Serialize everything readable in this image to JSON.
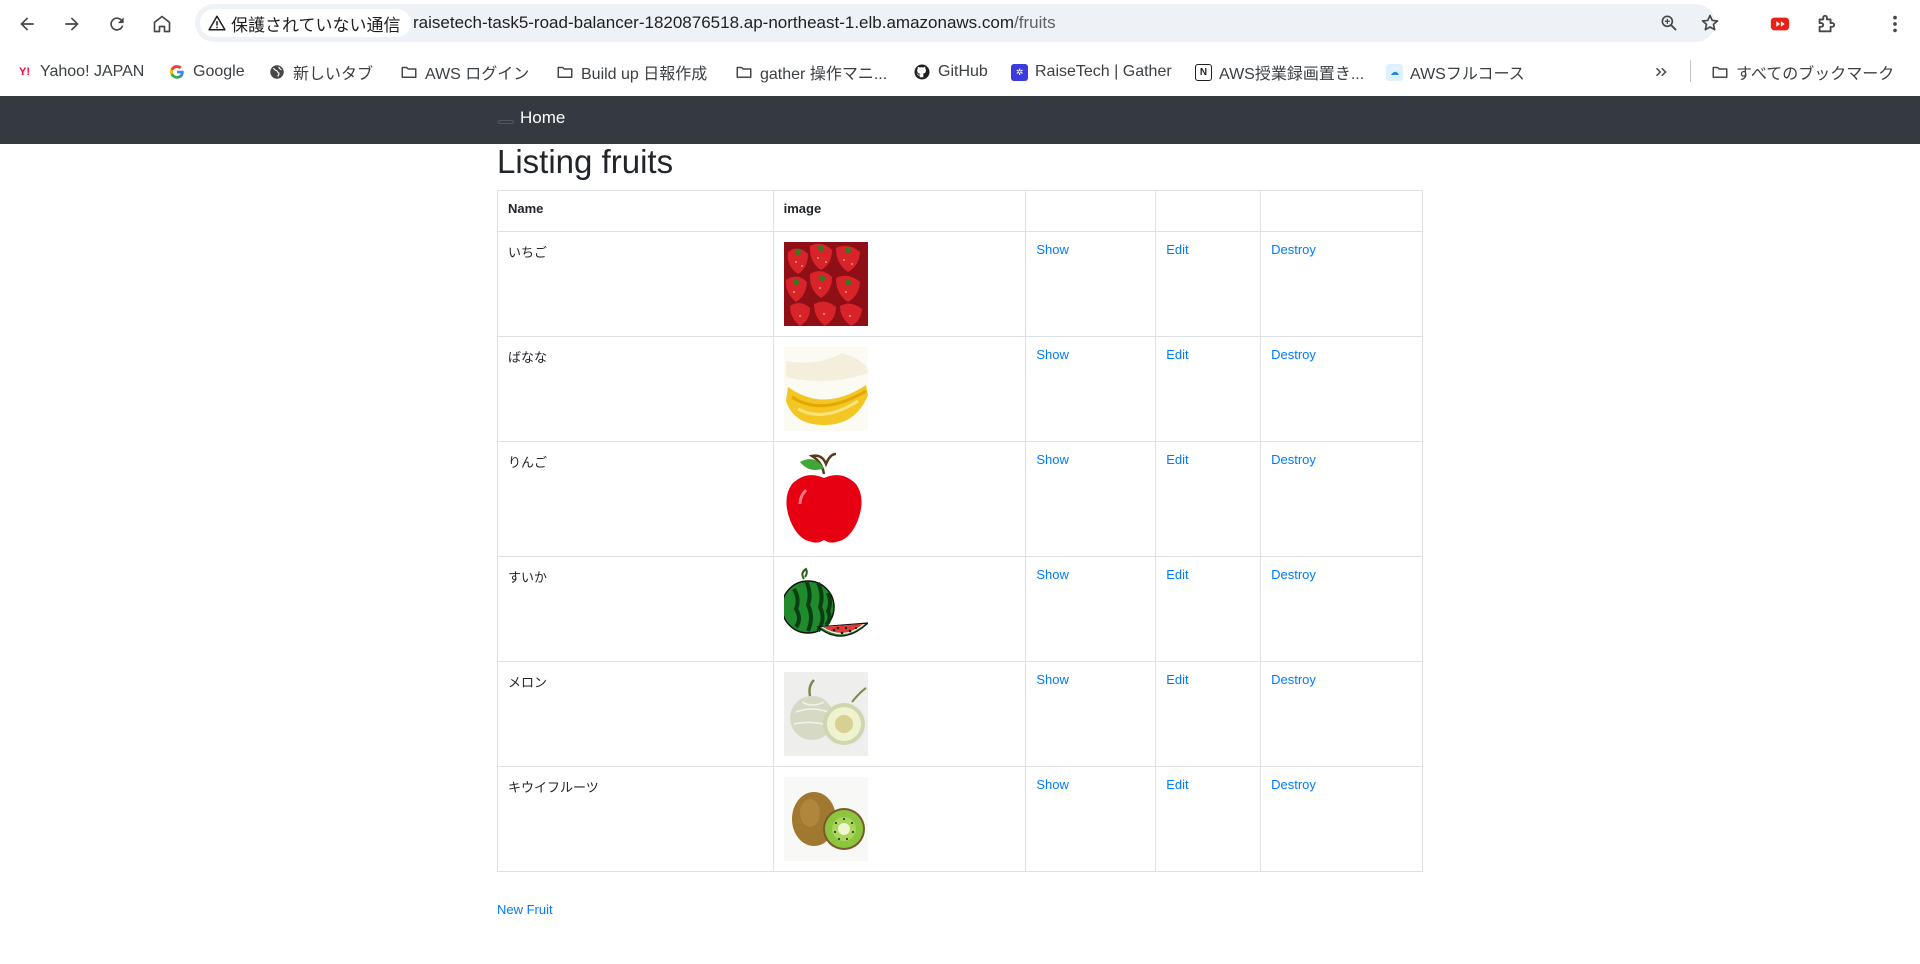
{
  "browser": {
    "security_label": "保護されていない通信",
    "url_host": "raisetech-task5-road-balancer-1820876518.ap-northeast-1.elb.amazonaws.com",
    "url_path": "/fruits"
  },
  "bookmarks": [
    {
      "label": "Yahoo! JAPAN",
      "icon": "yahoo-icon"
    },
    {
      "label": "Google",
      "icon": "google-icon"
    },
    {
      "label": "新しいタブ",
      "icon": "globe-icon"
    },
    {
      "label": "AWS ログイン",
      "icon": "folder-icon"
    },
    {
      "label": "Build up 日報作成",
      "icon": "folder-icon"
    },
    {
      "label": "gather 操作マニ...",
      "icon": "folder-icon"
    },
    {
      "label": "GitHub",
      "icon": "github-icon"
    },
    {
      "label": "RaiseTech | Gather",
      "icon": "gather-icon"
    },
    {
      "label": "AWS授業録画置き...",
      "icon": "notion-icon"
    },
    {
      "label": "AWSフルコース",
      "icon": "raisetech-icon"
    }
  ],
  "all_bookmarks_label": "すべてのブックマーク",
  "navbar": {
    "home_label": "Home"
  },
  "page": {
    "title": "Listing fruits",
    "columns": [
      "Name",
      "image",
      "",
      "",
      ""
    ],
    "rows": [
      {
        "name": "いちご",
        "image": "strawberry-image",
        "show": "Show",
        "edit": "Edit",
        "destroy": "Destroy"
      },
      {
        "name": "ばなな",
        "image": "banana-image",
        "show": "Show",
        "edit": "Edit",
        "destroy": "Destroy"
      },
      {
        "name": "りんご",
        "image": "apple-image",
        "show": "Show",
        "edit": "Edit",
        "destroy": "Destroy"
      },
      {
        "name": "すいか",
        "image": "watermelon-image",
        "show": "Show",
        "edit": "Edit",
        "destroy": "Destroy"
      },
      {
        "name": "メロン",
        "image": "melon-image",
        "show": "Show",
        "edit": "Edit",
        "destroy": "Destroy"
      },
      {
        "name": "キウイフルーツ",
        "image": "kiwi-image",
        "show": "Show",
        "edit": "Edit",
        "destroy": "Destroy"
      }
    ],
    "new_link": "New Fruit"
  },
  "colors": {
    "navbar": "#343a40",
    "link": "#007bff",
    "border": "#dee2e6"
  }
}
